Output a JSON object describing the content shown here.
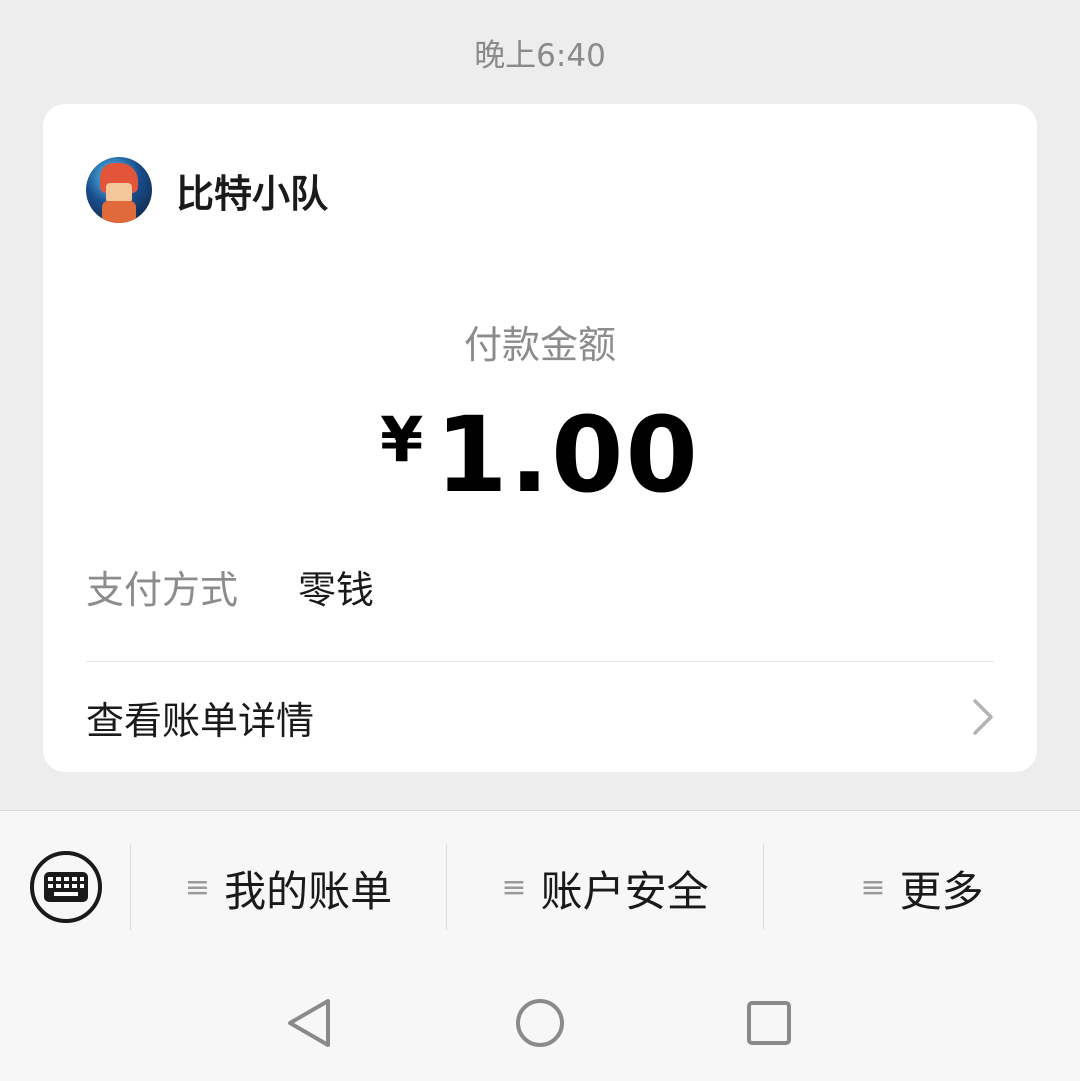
{
  "time": "晚上6:40",
  "merchant": {
    "name": "比特小队",
    "avatar_icon": "game-character-avatar"
  },
  "payment": {
    "amount_label": "付款金额",
    "currency": "¥",
    "amount": "1.00",
    "method_label": "支付方式",
    "method_value": "零钱",
    "detail_label": "查看账单详情"
  },
  "menu": {
    "keyboard_icon": "keyboard-icon",
    "items": [
      {
        "label": "我的账单",
        "icon": "menu-lines-icon"
      },
      {
        "label": "账户安全",
        "icon": "menu-lines-icon"
      },
      {
        "label": "更多",
        "icon": "menu-lines-icon"
      }
    ]
  },
  "nav": {
    "back_icon": "back-triangle-icon",
    "home_icon": "home-circle-icon",
    "recents_icon": "recents-square-icon"
  },
  "colors": {
    "background": "#ededed",
    "card": "#ffffff",
    "muted_text": "#8c8c8c"
  }
}
